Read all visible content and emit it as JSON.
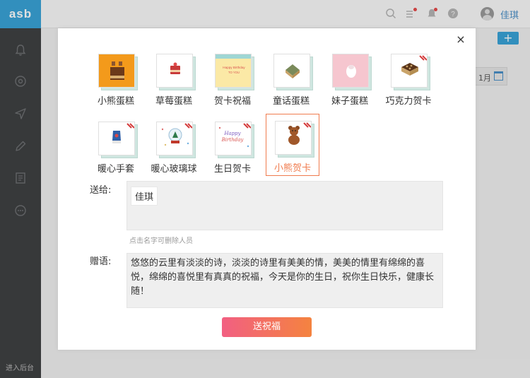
{
  "app": {
    "logo_text": "asb",
    "sidebar_footer": "进入后台"
  },
  "topbar": {
    "username": "佳琪"
  },
  "background": {
    "add_button": "+",
    "date_chip": "1月"
  },
  "dialog": {
    "close_label": "×",
    "cards": [
      {
        "label": "小熊蛋糕",
        "theme": "bear-cake",
        "bg": "#f39a1b",
        "selected": false
      },
      {
        "label": "草莓蛋糕",
        "theme": "strawberry-cake",
        "bg": "#ffffff",
        "selected": false
      },
      {
        "label": "贺卡祝福",
        "theme": "greeting-card",
        "bg": "#fbe9a6",
        "selected": false,
        "card_text": "Happy Birthday TO YOU"
      },
      {
        "label": "童话蛋糕",
        "theme": "fairy-cake",
        "bg": "#ffffff",
        "selected": false
      },
      {
        "label": "妹子蛋糕",
        "theme": "girl-cake",
        "bg": "#f6c6cf",
        "selected": false
      },
      {
        "label": "巧克力贺卡",
        "theme": "chocolate-card",
        "bg": "#ffffff",
        "selected": false
      },
      {
        "label": "暖心手套",
        "theme": "glove-card",
        "bg": "#ffffff",
        "selected": false
      },
      {
        "label": "暖心玻璃球",
        "theme": "snowglobe-card",
        "bg": "#ffffff",
        "selected": false
      },
      {
        "label": "生日贺卡",
        "theme": "birthday-card",
        "bg": "#ffffff",
        "selected": false,
        "card_text": "Happy Birthday"
      },
      {
        "label": "小熊贺卡",
        "theme": "bear-card",
        "bg": "#ffffff",
        "selected": true
      }
    ],
    "to_label": "送给:",
    "recipients": [
      "佳琪"
    ],
    "recipients_hint": "点击名字可删除人员",
    "message_label": "赠语:",
    "message": "悠悠的云里有淡淡的诗，淡淡的诗里有美美的情，美美的情里有绵绵的喜悦，绵绵的喜悦里有真真的祝福，今天是你的生日，祝你生日快乐，健康长随！",
    "send_label": "送祝福"
  },
  "colors": {
    "accent": "#f07b4e",
    "brand_blue": "#3aa3d8",
    "button_start": "#f25f82",
    "button_end": "#f4833f"
  }
}
